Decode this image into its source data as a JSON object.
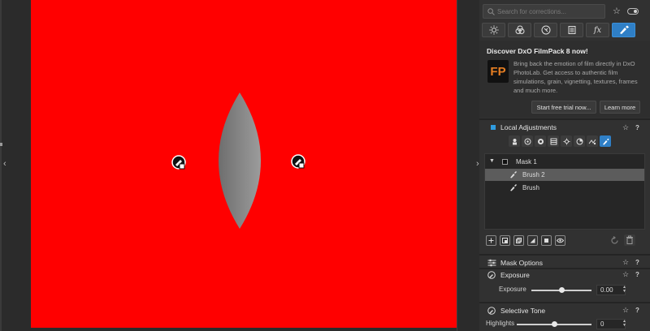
{
  "search": {
    "placeholder": "Search for corrections..."
  },
  "tabs": [
    {
      "icon": "light-icon"
    },
    {
      "icon": "color-icon"
    },
    {
      "icon": "detail-icon"
    },
    {
      "icon": "geometry-icon"
    },
    {
      "icon": "effects-icon",
      "label": "fx"
    },
    {
      "icon": "local-adjustments-icon",
      "active": true
    }
  ],
  "promo": {
    "title": "Discover DxO FilmPack 8 now!",
    "logo": "FP",
    "body": "Bring back the emotion of film directly in DxO PhotoLab. Get access to authentic film simulations, grain, vignetting, textures, frames and much more.",
    "trial_button": "Start free trial now...",
    "learn_button": "Learn more"
  },
  "local_adjustments": {
    "title": "Local Adjustments",
    "star": "☆",
    "help": "?",
    "masks": [
      {
        "label": "Mask 1",
        "expanded": true
      },
      {
        "label": "Brush 2",
        "selected": true
      },
      {
        "label": "Brush"
      }
    ]
  },
  "mask_options": {
    "title": "Mask Options",
    "star": "☆",
    "help": "?"
  },
  "exposure": {
    "title": "Exposure",
    "star": "☆",
    "help": "?",
    "slider_label": "Exposure",
    "value": "0.00",
    "position": 0.5
  },
  "selective_tone": {
    "title": "Selective Tone",
    "star": "☆",
    "help": "?",
    "slider_label": "Highlights",
    "value": "0",
    "position": 0.5
  },
  "colors": {
    "accent": "#2f7fc6",
    "image_fill": "#ff0000",
    "checkbox": "#2f9ce0",
    "logo_text": "#e67e22"
  }
}
